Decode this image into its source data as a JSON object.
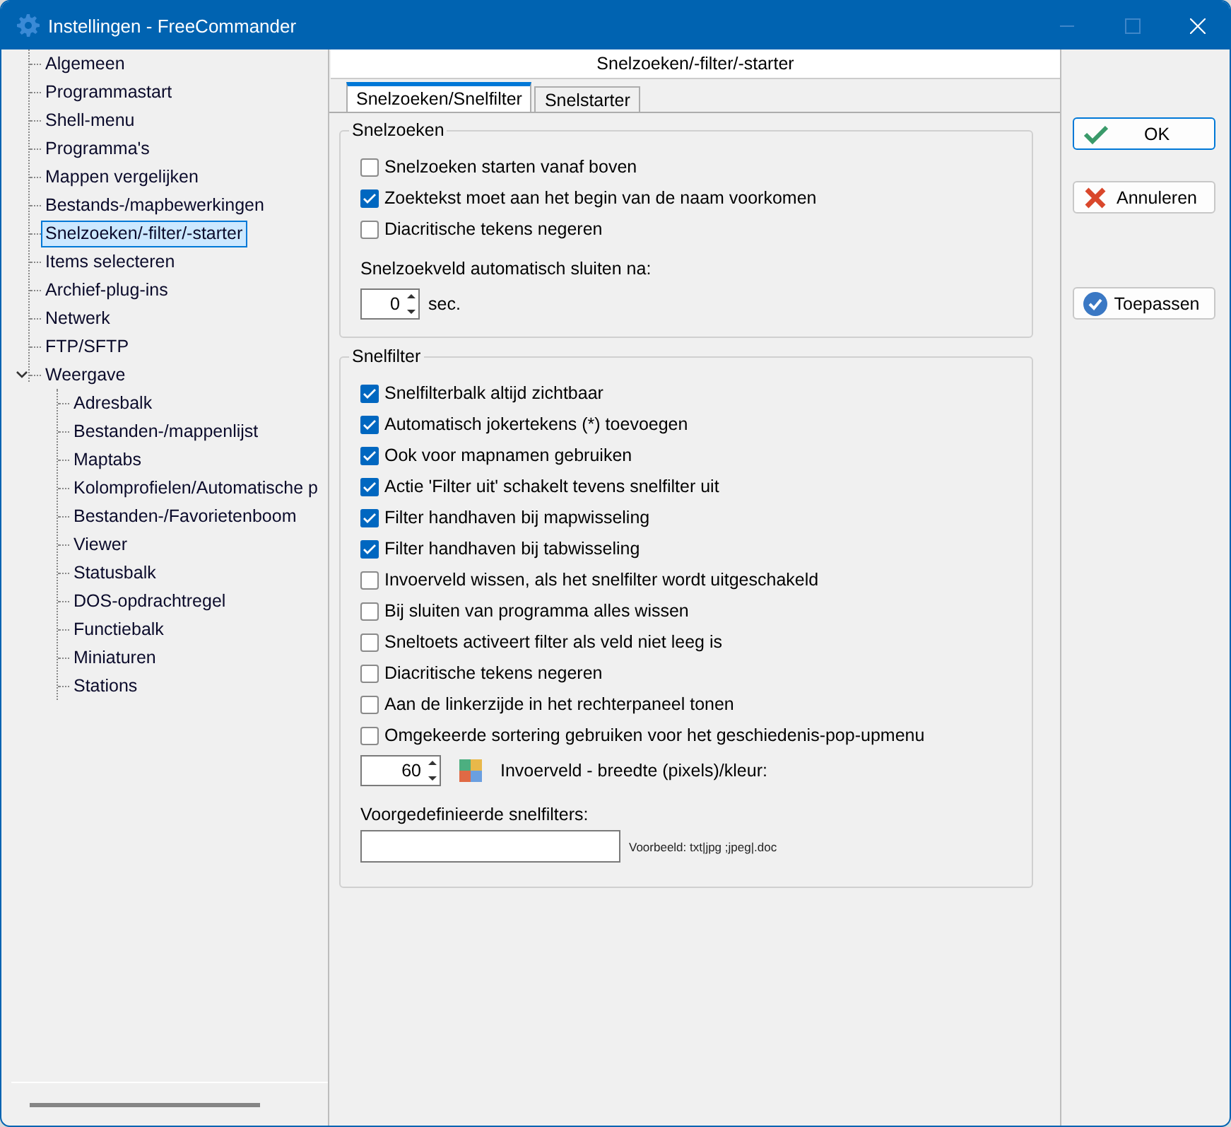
{
  "window": {
    "title": "Instellingen - FreeCommander"
  },
  "sidebar": {
    "items": [
      {
        "label": "Algemeen",
        "selected": false
      },
      {
        "label": "Programmastart",
        "selected": false
      },
      {
        "label": "Shell-menu",
        "selected": false
      },
      {
        "label": "Programma's",
        "selected": false
      },
      {
        "label": "Mappen vergelijken",
        "selected": false
      },
      {
        "label": "Bestands-/mapbewerkingen",
        "selected": false
      },
      {
        "label": "Snelzoeken/-filter/-starter",
        "selected": true
      },
      {
        "label": "Items selecteren",
        "selected": false
      },
      {
        "label": "Archief-plug-ins",
        "selected": false
      },
      {
        "label": "Netwerk",
        "selected": false
      },
      {
        "label": "FTP/SFTP",
        "selected": false
      },
      {
        "label": "Weergave",
        "selected": false,
        "expanded": true,
        "children": [
          {
            "label": "Adresbalk",
            "selected": false
          },
          {
            "label": "Bestanden-/mappenlijst",
            "selected": false
          },
          {
            "label": "Maptabs",
            "selected": false
          },
          {
            "label": "Kolomprofielen/Automatische p",
            "selected": false
          },
          {
            "label": "Bestanden-/Favorietenboom",
            "selected": false
          },
          {
            "label": "Viewer",
            "selected": false
          },
          {
            "label": "Statusbalk",
            "selected": false
          },
          {
            "label": "DOS-opdrachtregel",
            "selected": false
          },
          {
            "label": "Functiebalk",
            "selected": false
          },
          {
            "label": "Miniaturen",
            "selected": false
          },
          {
            "label": "Stations",
            "selected": false
          }
        ]
      }
    ]
  },
  "page": {
    "title": "Snelzoeken/-filter/-starter",
    "tabs": [
      {
        "label": "Snelzoeken/Snelfilter",
        "selected": true
      },
      {
        "label": "Snelstarter",
        "selected": false
      }
    ],
    "groups": [
      {
        "title": "Snelzoeken",
        "items": [
          {
            "kind": "checkbox",
            "label": "Snelzoeken starten vanaf boven",
            "checked": false
          },
          {
            "kind": "checkbox",
            "label": "Zoektekst moet aan het begin van de naam voorkomen",
            "checked": true
          },
          {
            "kind": "checkbox",
            "label": "Diacritische tekens negeren",
            "checked": false
          },
          {
            "kind": "label",
            "label": "Snelzoekveld automatisch sluiten na:"
          },
          {
            "kind": "spinner",
            "value": "0",
            "unit": "sec."
          }
        ]
      },
      {
        "title": "Snelfilter",
        "items": [
          {
            "kind": "checkbox",
            "label": "Snelfilterbalk altijd zichtbaar",
            "checked": true
          },
          {
            "kind": "checkbox",
            "label": "Automatisch jokertekens (*) toevoegen",
            "checked": true
          },
          {
            "kind": "checkbox",
            "label": "Ook voor mapnamen gebruiken",
            "checked": true
          },
          {
            "kind": "checkbox",
            "label": "Actie 'Filter uit' schakelt tevens snelfilter uit",
            "checked": true
          },
          {
            "kind": "checkbox",
            "label": "Filter handhaven bij mapwisseling",
            "checked": true
          },
          {
            "kind": "checkbox",
            "label": "Filter handhaven bij tabwisseling",
            "checked": true
          },
          {
            "kind": "checkbox",
            "label": "Invoerveld wissen, als het snelfilter wordt uitgeschakeld",
            "checked": false
          },
          {
            "kind": "checkbox",
            "label": "Bij sluiten van programma alles wissen",
            "checked": false
          },
          {
            "kind": "checkbox",
            "label": "Sneltoets activeert filter als veld niet leeg is",
            "checked": false
          },
          {
            "kind": "checkbox",
            "label": "Diacritische tekens negeren",
            "checked": false
          },
          {
            "kind": "checkbox",
            "label": "Aan de linkerzijde in het rechterpaneel tonen",
            "checked": false
          },
          {
            "kind": "checkbox",
            "label": "Omgekeerde sortering gebruiken voor het geschiedenis-pop-upmenu",
            "checked": false
          },
          {
            "kind": "spinner_color",
            "value": "60",
            "unit": "Invoerveld - breedte (pixels)/kleur:"
          },
          {
            "kind": "label",
            "label": "Voorgedefinieerde snelfilters:"
          },
          {
            "kind": "field",
            "note": "Voorbeeld: txt|jpg ;jpeg|.doc"
          }
        ]
      }
    ]
  },
  "buttons": [
    {
      "label": "OK",
      "kind": "check",
      "focused": true
    },
    {
      "label": "Annuleren",
      "kind": "cross",
      "focused": false
    },
    {
      "label": "Toepassen",
      "kind": "check-circle",
      "focused": false
    }
  ]
}
